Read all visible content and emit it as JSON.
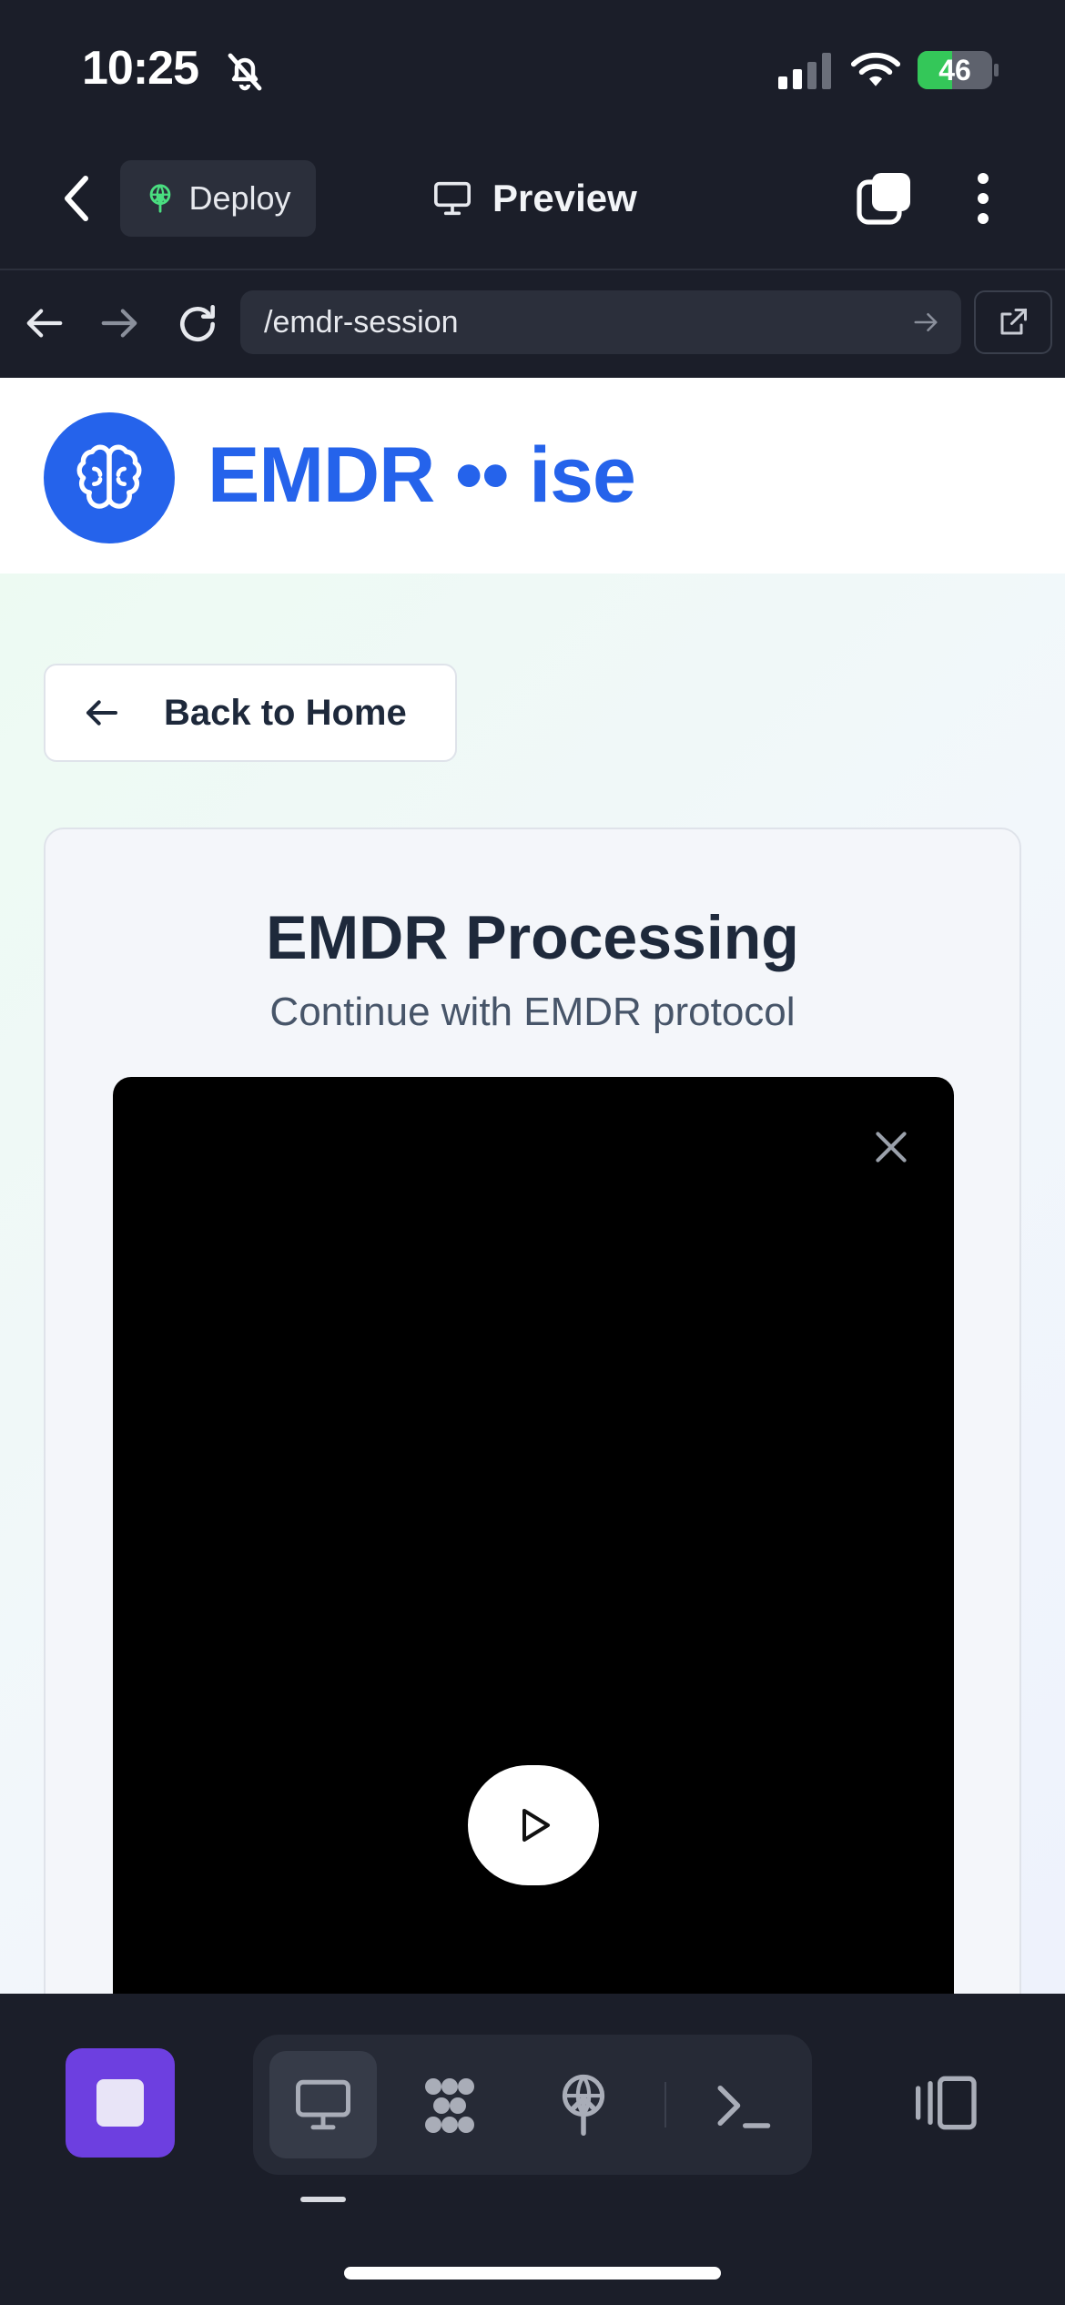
{
  "status_bar": {
    "time": "10:25",
    "battery": "46"
  },
  "app_header": {
    "deploy_label": "Deploy",
    "preview_label": "Preview"
  },
  "browser": {
    "url": "/emdr-session"
  },
  "site": {
    "logo_text": "EMDR •• ise",
    "back_label": "Back to Home",
    "card_title": "EMDR Processing",
    "card_subtitle": "Continue with EMDR protocol"
  },
  "colors": {
    "brand": "#2563eb",
    "stop": "#6d3fe0",
    "battery": "#34c759",
    "dark_bg": "#1b1e29"
  }
}
